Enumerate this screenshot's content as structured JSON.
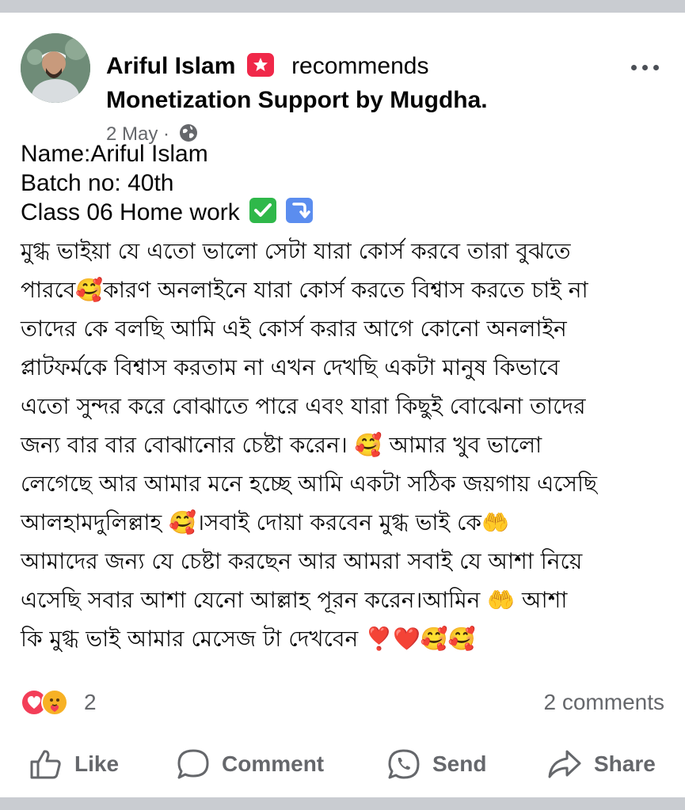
{
  "post": {
    "author": "Ariful Islam",
    "verb": "recommends",
    "group": "Monetization Support by Mugdha.",
    "date": "2 May",
    "date_separator": "·",
    "audience_icon": "globe-icon",
    "badge_icon": "star-badge-icon",
    "more_icon": "more-options-icon"
  },
  "content": {
    "line1": "Name:Ariful Islam",
    "line2": "Batch no: 40th",
    "line3": "Class 06 Home work",
    "line3_emojis": [
      "✅",
      "⤵️"
    ],
    "bengali_lines": [
      "মুগ্ধ ভাইয়া যে এতো ভালো সেটা যারা কোর্স করবে তারা বুঝতে",
      "পারবে🥰কারণ অনলাইনে যারা কোর্স করতে বিশ্বাস করতে চাই না",
      "তাদের কে বলছি আমি এই কোর্স করার আগে কোনো অনলাইন",
      "প্লাটফর্মকে বিশ্বাস করতাম না এখন দেখছি একটা মানুষ কিভাবে",
      "এতো সুন্দর করে বোঝাতে পারে এবং যারা কিছুই বোঝেনা তাদের",
      "জন্য বার বার বোঝানোর চেষ্টা করেন। 🥰 আমার খুব ভালো",
      "লেগেছে আর আমার মনে হচ্ছে আমি একটা সঠিক জয়গায় এসেছি",
      "আলহামদুলিল্লাহ 🥰।সবাই দোয়া করবেন মুগ্ধ ভাই কে🤲",
      "আমাদের জন্য যে চেষ্টা করছেন আর আমরা সবাই যে আশা নিয়ে",
      "এসেছি সবার আশা যেনো আল্লাহ পূরন করেন।আমিন 🤲 আশা",
      "কি মুগ্ধ ভাই আমার মেসেজ টা দেখবেন ❣️❤️🥰🥰"
    ]
  },
  "stats": {
    "reaction_icons": [
      "love-reaction-icon",
      "care-reaction-icon"
    ],
    "reaction_count": "2",
    "comments": "2 comments"
  },
  "actions": {
    "like": "Like",
    "comment": "Comment",
    "send": "Send",
    "share": "Share"
  },
  "colors": {
    "background": "#c9ccd1",
    "card": "#ffffff",
    "secondary_text": "#65676b",
    "badge": "#f02849",
    "love": "#f33e58",
    "care": "#f7b125"
  }
}
